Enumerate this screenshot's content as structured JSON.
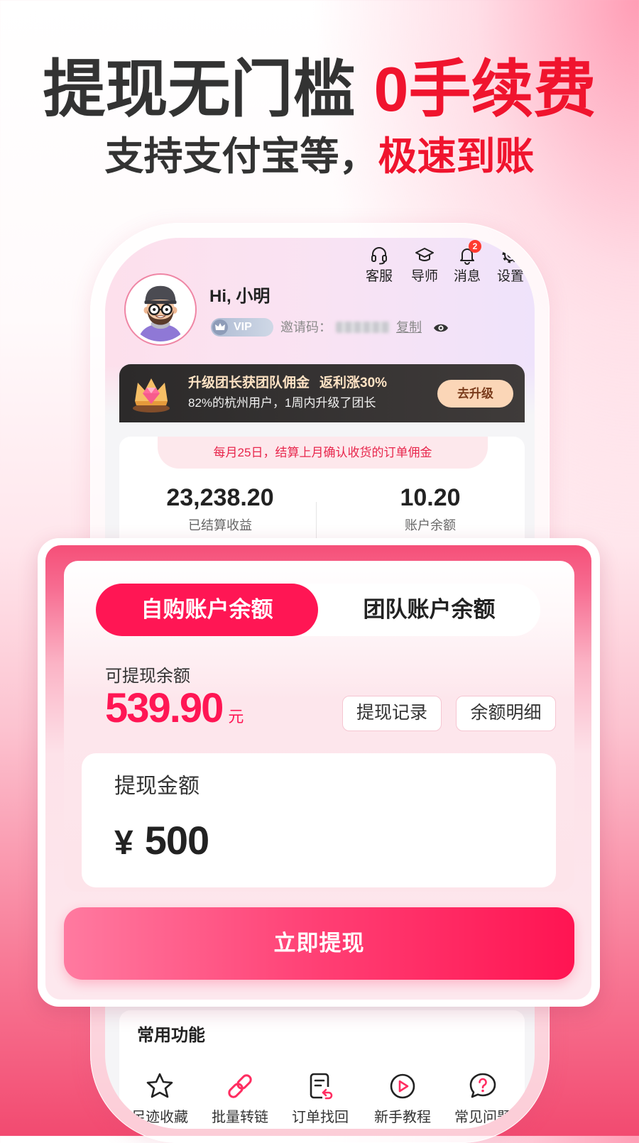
{
  "colors": {
    "accent": "#ff1654",
    "headline_highlight": "#f0142e",
    "promo_button_bg": "#fbd6b7",
    "icon_accent": "#ff2d61"
  },
  "headline": {
    "main": "提现无门槛",
    "highlight": "0手续费"
  },
  "subheadline": {
    "main": "支持支付宝等，",
    "highlight": "极速到账"
  },
  "top_nav": [
    {
      "label": "客服",
      "icon": "headset-icon"
    },
    {
      "label": "导师",
      "icon": "graduation-cap-icon"
    },
    {
      "label": "消息",
      "icon": "bell-icon",
      "badge": "2"
    },
    {
      "label": "设置",
      "icon": "gear-icon"
    }
  ],
  "profile": {
    "greeting": "Hi, 小明",
    "vip_label": "VIP",
    "invite_label": "邀请码：",
    "copy_label": "复制"
  },
  "promo": {
    "title": "升级团长获团队佣金",
    "title_highlight": "返利涨30%",
    "subtitle": "82%的杭州用户，1周内升级了团长",
    "button": "去升级"
  },
  "earnings": {
    "notice": "每月25日，结算上月确认收货的订单佣金",
    "settled": {
      "value": "23,238.20",
      "label": "已结算收益"
    },
    "balance": {
      "value": "10.20",
      "label": "账户余额"
    }
  },
  "withdraw": {
    "tabs": [
      {
        "label": "自购账户余额",
        "active": true
      },
      {
        "label": "团队账户余额",
        "active": false
      }
    ],
    "available_label": "可提现余额",
    "available_value": "539.90",
    "currency_unit": "元",
    "records_button": "提现记录",
    "details_button": "余额明细",
    "amount_label": "提现金额",
    "currency_symbol": "¥",
    "amount_value": "500",
    "submit_button": "立即提现"
  },
  "common_functions": {
    "title": "常用功能",
    "items": [
      {
        "label": "足迹收藏",
        "icon": "star-icon"
      },
      {
        "label": "批量转链",
        "icon": "link-icon"
      },
      {
        "label": "订单找回",
        "icon": "order-return-icon"
      },
      {
        "label": "新手教程",
        "icon": "play-icon"
      },
      {
        "label": "常见问题",
        "icon": "question-icon"
      }
    ]
  }
}
